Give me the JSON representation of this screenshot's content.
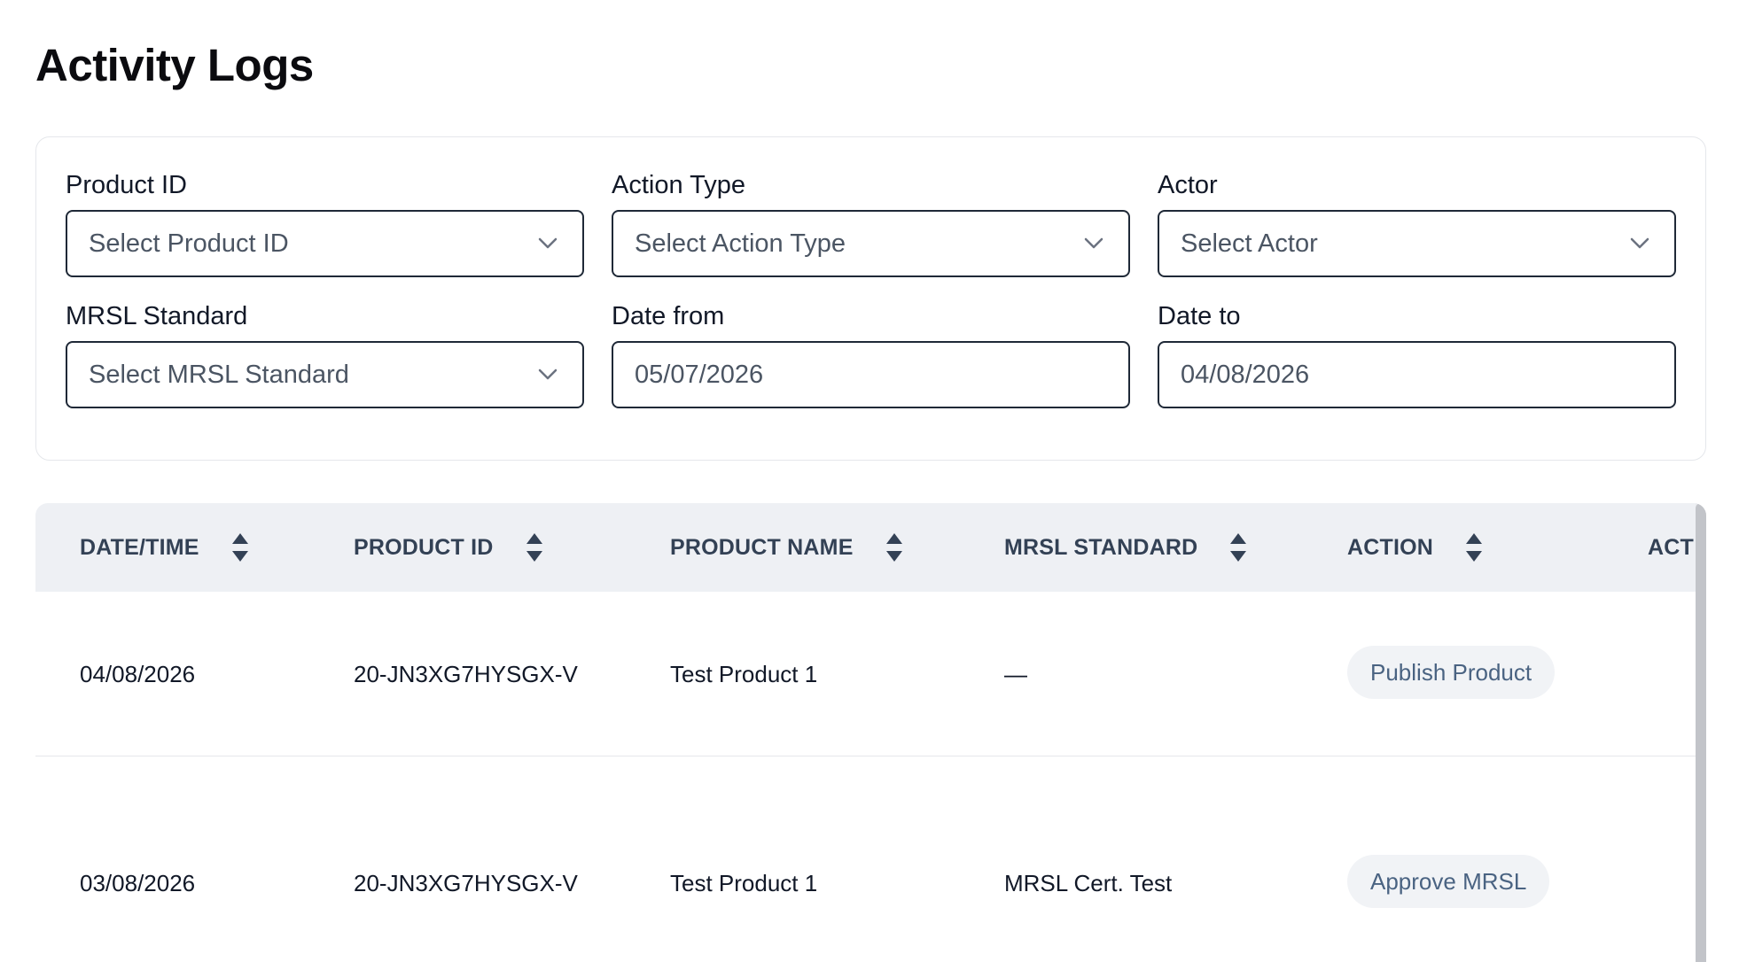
{
  "page": {
    "title": "Activity Logs"
  },
  "filters": {
    "product_id": {
      "label": "Product ID",
      "placeholder": "Select Product ID"
    },
    "action_type": {
      "label": "Action Type",
      "placeholder": "Select Action Type"
    },
    "actor": {
      "label": "Actor",
      "placeholder": "Select Actor"
    },
    "mrsl_standard": {
      "label": "MRSL Standard",
      "placeholder": "Select MRSL Standard"
    },
    "date_from": {
      "label": "Date from",
      "value": "05/07/2026"
    },
    "date_to": {
      "label": "Date to",
      "value": "04/08/2026"
    }
  },
  "table": {
    "columns": [
      "DATE/TIME",
      "PRODUCT ID",
      "PRODUCT NAME",
      "MRSL STANDARD",
      "ACTION",
      "ACT"
    ],
    "rows": [
      {
        "datetime": "04/08/2026",
        "product_id": "20-JN3XG7HYSGX-V",
        "product_name": "Test Product 1",
        "mrsl_standard": "—",
        "action": "Publish Product"
      },
      {
        "datetime": "03/08/2026",
        "product_id": "20-JN3XG7HYSGX-V",
        "product_name": "Test Product 1",
        "mrsl_standard": "MRSL Cert. Test",
        "action": "Approve MRSL"
      }
    ]
  },
  "icons": {
    "dropdown": "chevron-down-icon",
    "sort": "sort-icon",
    "row_menu": "more-icon"
  },
  "colors": {
    "header_bg": "#eef0f4",
    "pill_bg": "#f1f3f6",
    "pill_text": "#4a6382",
    "border": "#1f2937"
  }
}
